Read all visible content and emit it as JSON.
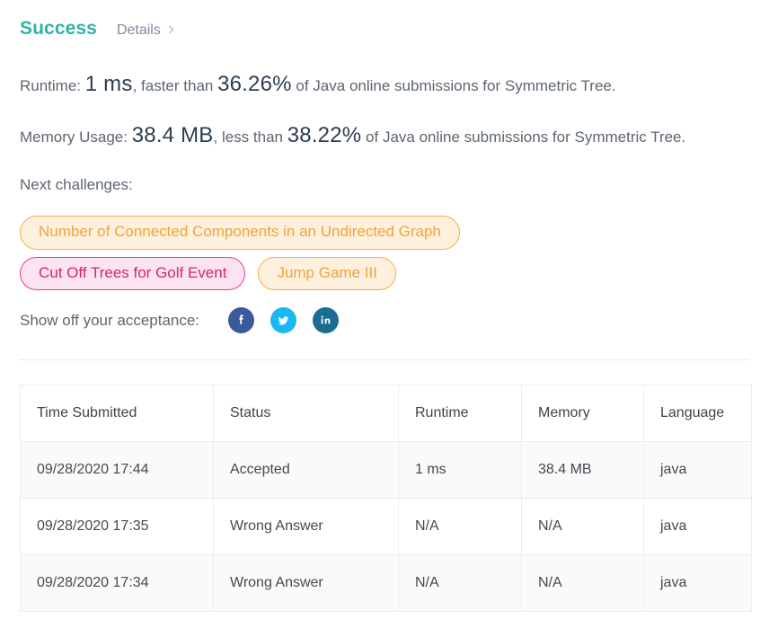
{
  "header": {
    "status_title": "Success",
    "details_label": "Details",
    "chevron_icon": "chevron-right-icon"
  },
  "stats": {
    "runtime": {
      "label": "Runtime:",
      "value": "1 ms",
      "comparator": ", faster than ",
      "percentile": "36.26%",
      "suffix": " of Java online submissions for Symmetric Tree."
    },
    "memory": {
      "label": "Memory Usage:",
      "value": "38.4 MB",
      "comparator": ", less than ",
      "percentile": "38.22%",
      "suffix": " of Java online submissions for Symmetric Tree."
    }
  },
  "challenges": {
    "label": "Next challenges:",
    "tags": [
      {
        "text": "Number of Connected Components in an Undirected Graph",
        "style": "orange"
      },
      {
        "text": "Cut Off Trees for Golf Event",
        "style": "pink"
      },
      {
        "text": "Jump Game III",
        "style": "orange"
      }
    ]
  },
  "share": {
    "label": "Show off your acceptance:",
    "buttons": [
      {
        "name": "facebook-icon",
        "title": "Facebook",
        "color": "#3b5a9b"
      },
      {
        "name": "twitter-icon",
        "title": "Twitter",
        "color": "#1cb7f2"
      },
      {
        "name": "linkedin-icon",
        "title": "LinkedIn",
        "color": "#1a6c92"
      }
    ]
  },
  "submissions_table": {
    "columns": [
      "Time Submitted",
      "Status",
      "Runtime",
      "Memory",
      "Language"
    ],
    "rows": [
      {
        "time": "09/28/2020 17:44",
        "status": "Accepted",
        "status_type": "accepted",
        "runtime": "1 ms",
        "memory": "38.4 MB",
        "language": "java"
      },
      {
        "time": "09/28/2020 17:35",
        "status": "Wrong Answer",
        "status_type": "wrong",
        "runtime": "N/A",
        "memory": "N/A",
        "language": "java"
      },
      {
        "time": "09/28/2020 17:34",
        "status": "Wrong Answer",
        "status_type": "wrong",
        "runtime": "N/A",
        "memory": "N/A",
        "language": "java"
      }
    ]
  },
  "colors": {
    "success_teal": "#2db3a6",
    "error_red": "#c0392b",
    "tag_orange_text": "#f2a33c",
    "tag_orange_border": "#f6b03c",
    "tag_orange_bg": "#fdf0dd",
    "tag_pink_text": "#d6246f",
    "tag_pink_border": "#e0409a",
    "tag_pink_bg": "#fbe4ef",
    "body_text": "#5c6670"
  }
}
